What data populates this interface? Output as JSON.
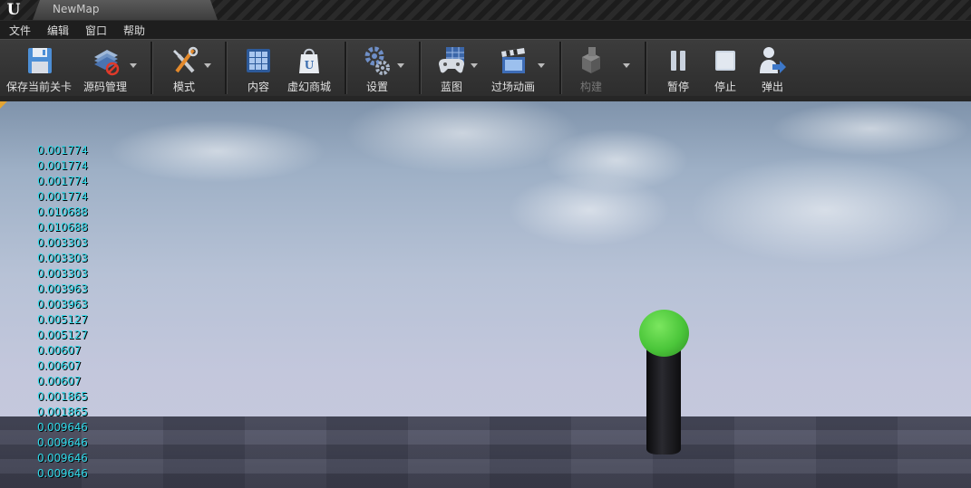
{
  "app": {
    "logo": "U",
    "tab_title": "NewMap"
  },
  "menu": [
    "文件",
    "编辑",
    "窗口",
    "帮助"
  ],
  "toolbar": {
    "items": [
      {
        "label": "保存当前关卡",
        "icon": "floppy-save-icon",
        "dropdown": false,
        "disabled": false
      },
      {
        "label": "源码管理",
        "icon": "source-control-icon",
        "dropdown": true,
        "disabled": false
      },
      {
        "label": "模式",
        "icon": "modes-tools-icon",
        "dropdown": true,
        "disabled": false
      },
      {
        "label": "内容",
        "icon": "content-grid-icon",
        "dropdown": false,
        "disabled": false
      },
      {
        "label": "虚幻商城",
        "icon": "marketplace-bag-icon",
        "dropdown": false,
        "disabled": false
      },
      {
        "label": "设置",
        "icon": "settings-gears-icon",
        "dropdown": true,
        "disabled": false
      },
      {
        "label": "蓝图",
        "icon": "blueprint-gamepad-icon",
        "dropdown": true,
        "disabled": false
      },
      {
        "label": "过场动画",
        "icon": "cinematics-clapper-icon",
        "dropdown": true,
        "disabled": false
      },
      {
        "label": "构建",
        "icon": "build-cubes-icon",
        "dropdown": true,
        "disabled": true
      },
      {
        "label": "暂停",
        "icon": "pause-icon",
        "dropdown": false,
        "disabled": false
      },
      {
        "label": "停止",
        "icon": "stop-icon",
        "dropdown": false,
        "disabled": false
      },
      {
        "label": "弹出",
        "icon": "eject-person-icon",
        "dropdown": false,
        "disabled": false
      }
    ]
  },
  "viewport": {
    "debug_values": [
      "0.001774",
      "0.001774",
      "0.001774",
      "0.001774",
      "0.010688",
      "0.010688",
      "0.003303",
      "0.003303",
      "0.003303",
      "0.003963",
      "0.003963",
      "0.005127",
      "0.005127",
      "0.00607",
      "0.00607",
      "0.00607",
      "0.001865",
      "0.001865",
      "0.009646",
      "0.009646",
      "0.009646",
      "0.009646"
    ],
    "colors": {
      "debug_text": "#30d8e8",
      "sphere": "#4bc63a",
      "pole": "#111114"
    }
  }
}
